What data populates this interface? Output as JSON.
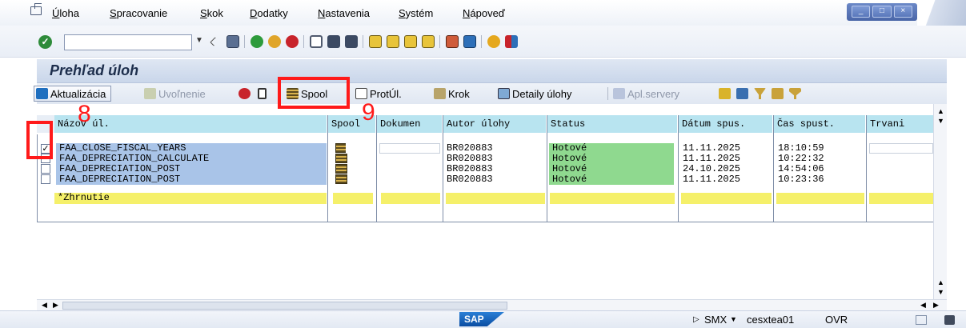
{
  "menu": {
    "items": [
      "Úloha",
      "Spracovanie",
      "Skok",
      "Dodatky",
      "Nastavenia",
      "Systém",
      "Nápoveď"
    ]
  },
  "title": "Prehľad úloh",
  "toolbar": {
    "refresh_label": "Aktualizácia",
    "release_label": "Uvoľnenie",
    "spool_label": "Spool",
    "joblog_label": "ProtÚl.",
    "step_label": "Krok",
    "details_label": "Detaily úlohy",
    "appservers_label": "Apl.servery"
  },
  "table": {
    "columns": [
      "Názov úl.",
      "Spool",
      "Dokumen",
      "Autor úlohy",
      "Status",
      "Dátum spus.",
      "Čas spust.",
      "Trvani"
    ],
    "rows": [
      {
        "checked": true,
        "name": "FAA_CLOSE_FISCAL_YEARS",
        "author": "BR020883",
        "status": "Hotové",
        "date": "11.11.2025",
        "time": "18:10:59"
      },
      {
        "checked": false,
        "name": "FAA_DEPRECIATION_CALCULATE",
        "author": "BR020883",
        "status": "Hotové",
        "date": "11.11.2025",
        "time": "10:22:32"
      },
      {
        "checked": false,
        "name": "FAA_DEPRECIATION_POST",
        "author": "BR020883",
        "status": "Hotové",
        "date": "24.10.2025",
        "time": "14:54:06"
      },
      {
        "checked": false,
        "name": "FAA_DEPRECIATION_POST",
        "author": "BR020883",
        "status": "Hotové",
        "date": "11.11.2025",
        "time": "10:23:36"
      }
    ],
    "summary_label": "*Zhrnutie"
  },
  "annotations": {
    "checkbox_number": "8",
    "spool_number": "9",
    "color": "#ff1a1a"
  },
  "statusbar": {
    "system": "SMX",
    "server": "cesxtea01",
    "mode": "OVR",
    "logo": "SAP"
  },
  "colors": {
    "header_bg": "#b8e4f0",
    "name_cell_bg": "#a9c4e8",
    "status_done_bg": "#8fd98f",
    "summary_bg": "#f5f06a"
  }
}
